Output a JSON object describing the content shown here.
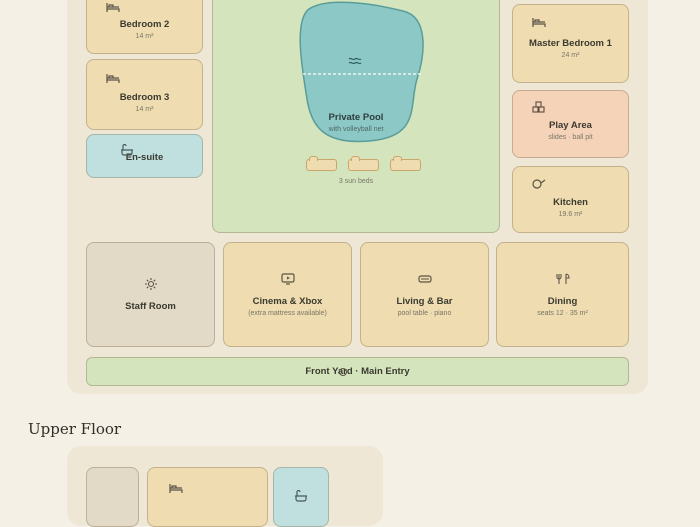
{
  "ground_floor": {
    "bedroom2": {
      "name": "Bedroom 2",
      "area": "14 m²",
      "icon": "bed-icon"
    },
    "bedroom3": {
      "name": "Bedroom 3",
      "area": "14 m²",
      "icon": "bed-icon"
    },
    "ensuite": {
      "name": "En-suite",
      "icon": "bathtub-icon"
    },
    "pool": {
      "name": "Private Pool",
      "note": "with volleyball net",
      "icon": "waves-icon",
      "sunbeds_caption": "3 sun beds",
      "sunbed_count": 3
    },
    "master": {
      "name": "Master Bedroom 1",
      "area": "24 m²",
      "icon": "bed-icon"
    },
    "play": {
      "name": "Play Area",
      "note": "slides · ball pit",
      "icon": "blocks-icon"
    },
    "kitchen": {
      "name": "Kitchen",
      "area": "19.6 m²",
      "icon": "pan-icon"
    },
    "staff": {
      "name": "Staff Room",
      "icon": "sun-icon"
    },
    "cinema": {
      "name": "Cinema & Xbox",
      "note": "(extra mattress available)",
      "icon": "tv-icon"
    },
    "living": {
      "name": "Living & Bar",
      "note": "pool table · piano",
      "icon": "sofa-icon"
    },
    "dining": {
      "name": "Dining",
      "note": "seats 12 · 35 m²",
      "icon": "cutlery-icon"
    },
    "entry": {
      "name": "Front Yard · Main Entry",
      "icon": "door-icon"
    }
  },
  "upper_floor": {
    "title": "Upper Floor"
  },
  "colors": {
    "background": "#f5f0e6",
    "plan": "#efe7d6",
    "bedroom": "#efdcb0",
    "bath": "#bfe0df",
    "play": "#f5d3b8",
    "staff": "#e2d9c6",
    "outdoor": "#d4e4bd",
    "pool": "#8cc8c6"
  }
}
